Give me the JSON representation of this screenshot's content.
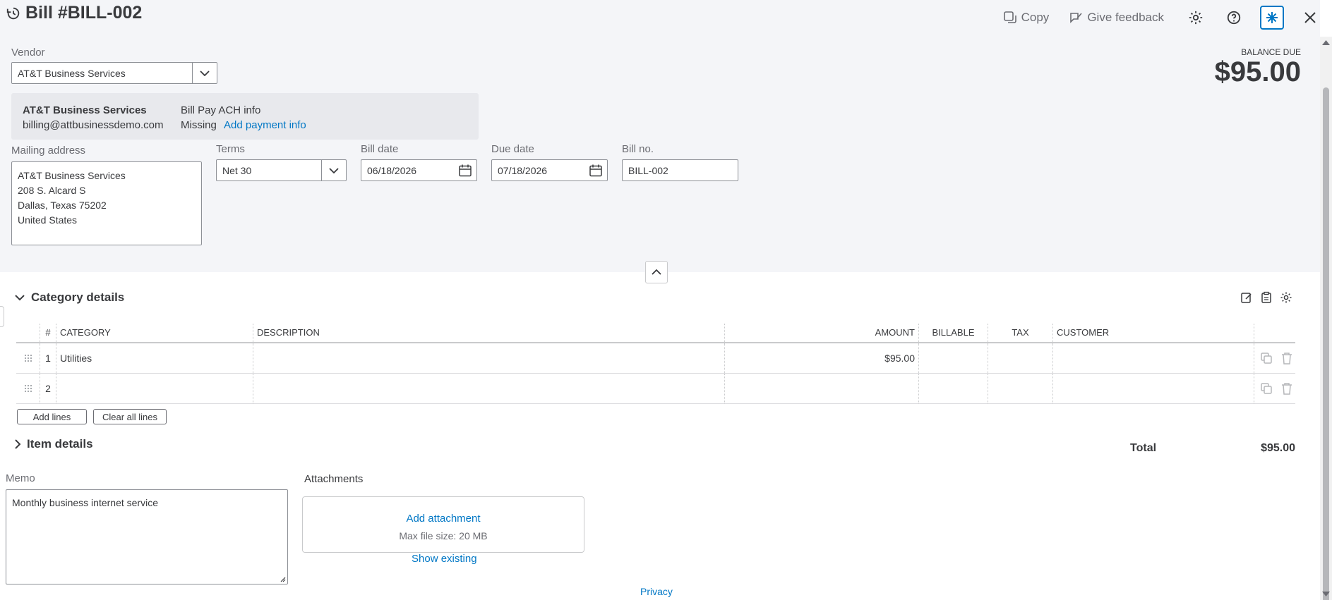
{
  "header": {
    "title": "Bill #BILL-002",
    "copy_label": "Copy",
    "feedback_label": "Give feedback"
  },
  "vendor": {
    "label": "Vendor",
    "value": "AT&T Business Services",
    "card_name": "AT&T Business Services",
    "card_email": "billing@attbusinessdemo.com",
    "ach_title": "Bill Pay ACH info",
    "ach_status": "Missing",
    "ach_link": "Add payment info"
  },
  "balance": {
    "label": "BALANCE DUE",
    "value": "$95.00"
  },
  "mailing": {
    "label": "Mailing address",
    "lines": [
      "AT&T Business Services",
      "208 S. Alcard S",
      "Dallas, Texas  75202",
      "United States"
    ]
  },
  "terms": {
    "label": "Terms",
    "value": "Net 30"
  },
  "bill_date": {
    "label": "Bill date",
    "value": "06/18/2026"
  },
  "due_date": {
    "label": "Due date",
    "value": "07/18/2026"
  },
  "bill_no": {
    "label": "Bill no.",
    "value": "BILL-002"
  },
  "category_details": {
    "title": "Category details",
    "columns": {
      "num": "#",
      "category": "CATEGORY",
      "description": "DESCRIPTION",
      "amount": "AMOUNT",
      "billable": "BILLABLE",
      "tax": "TAX",
      "customer": "CUSTOMER"
    },
    "rows": [
      {
        "num": "1",
        "category": "Utilities",
        "description": "",
        "amount": "$95.00",
        "billable": "",
        "tax": "",
        "customer": ""
      },
      {
        "num": "2",
        "category": "",
        "description": "",
        "amount": "",
        "billable": "",
        "tax": "",
        "customer": ""
      }
    ],
    "add_lines": "Add lines",
    "clear_lines": "Clear all lines"
  },
  "item_details": {
    "title": "Item details"
  },
  "total": {
    "label": "Total",
    "value": "$95.00"
  },
  "memo": {
    "label": "Memo",
    "value": "Monthly business internet service"
  },
  "attachments": {
    "label": "Attachments",
    "add": "Add attachment",
    "max_size": "Max file size: 20 MB",
    "show_existing": "Show existing"
  },
  "footer": {
    "privacy": "Privacy"
  },
  "colors": {
    "accent": "#0077c5",
    "panel": "#f4f5f8",
    "text": "#393a3d"
  }
}
